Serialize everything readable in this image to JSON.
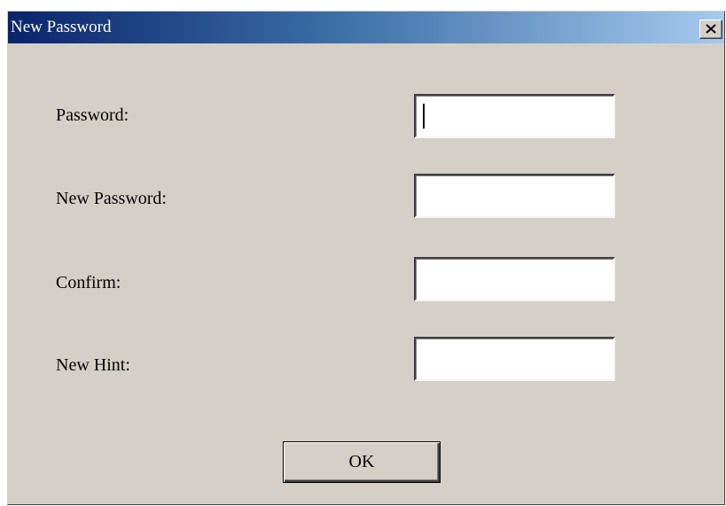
{
  "window": {
    "title": "New Password"
  },
  "form": {
    "fields": [
      {
        "label": "Password:",
        "value": ""
      },
      {
        "label": "New Password:",
        "value": ""
      },
      {
        "label": "Confirm:",
        "value": ""
      },
      {
        "label": "New Hint:",
        "value": ""
      }
    ],
    "ok_label": "OK"
  },
  "icons": {
    "close": "close-icon"
  },
  "colors": {
    "dialog_bg": "#d4d0c8",
    "titlebar_start": "#0a246a",
    "titlebar_end": "#a6caf0",
    "title_text": "#ffffff"
  }
}
